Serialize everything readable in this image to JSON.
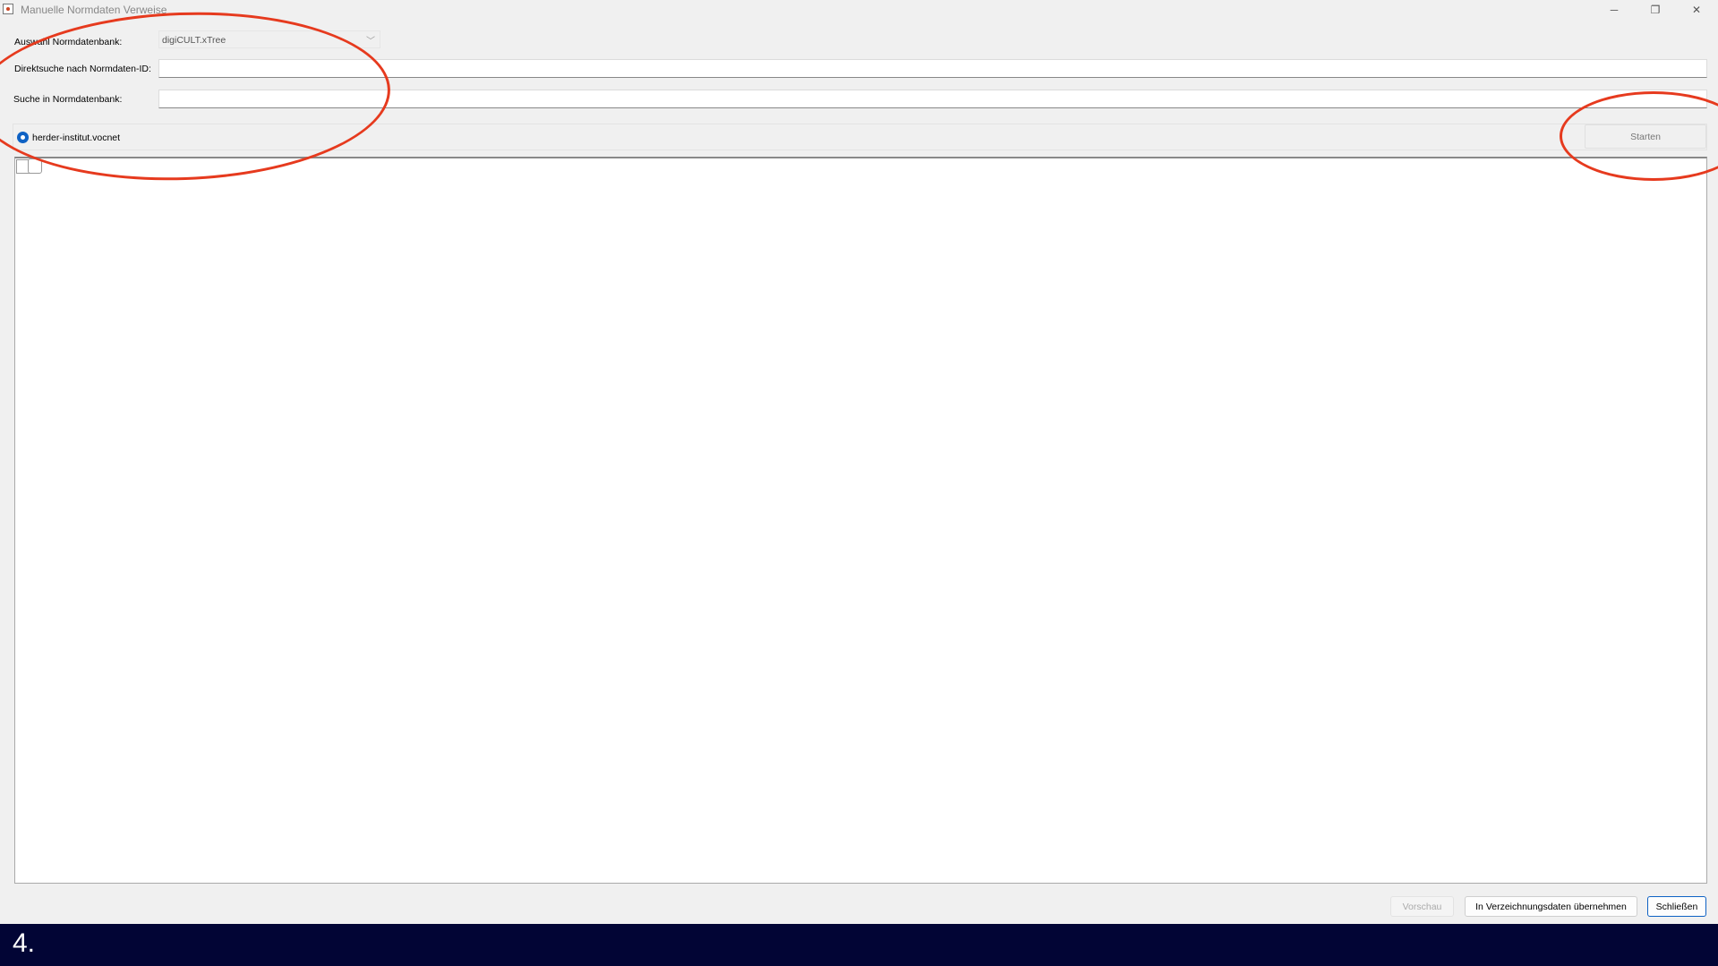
{
  "window": {
    "title": "Manuelle Normdaten Verweise",
    "icon": "app-icon",
    "controls": {
      "minimize": "─",
      "maximize": "❐",
      "close": "✕"
    }
  },
  "form": {
    "db_label": "Auswahl Normdatenbank:",
    "db_value": "digiCULT.xTree",
    "direct_label": "Direktsuche nach Normdaten-ID:",
    "direct_value": "",
    "search_label": "Suche in Normdatenbank:",
    "search_value": ""
  },
  "source": {
    "radio_label": "herder-institut.vocnet",
    "selected": true
  },
  "actions": {
    "start": "Starten",
    "preview": "Vorschau",
    "apply": "In Verzeichnungsdaten übernehmen",
    "close": "Schließen"
  },
  "annotation": {
    "step": "4.",
    "accent": "#e63a1e",
    "footer_color": "#020535"
  }
}
